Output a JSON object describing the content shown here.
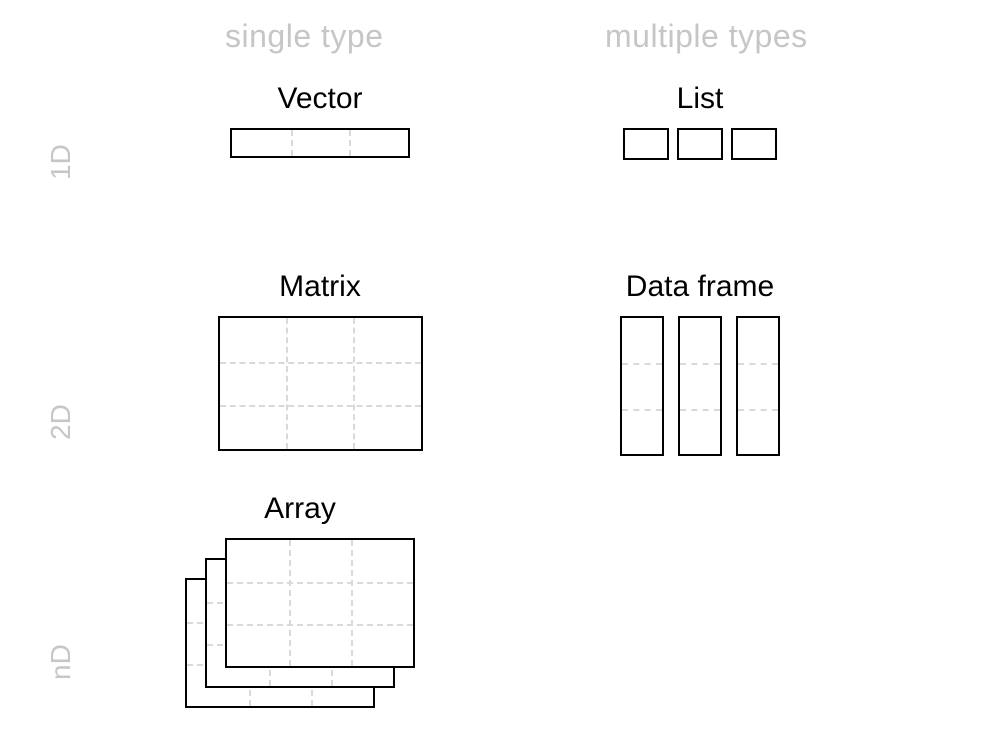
{
  "columns": {
    "single": "single type",
    "multiple": "multiple types"
  },
  "rows": {
    "d1": "1D",
    "d2": "2D",
    "dn": "nD"
  },
  "cells": {
    "vector": {
      "title": "Vector"
    },
    "list": {
      "title": "List"
    },
    "matrix": {
      "title": "Matrix"
    },
    "dataframe": {
      "title": "Data frame"
    },
    "array": {
      "title": "Array"
    }
  }
}
